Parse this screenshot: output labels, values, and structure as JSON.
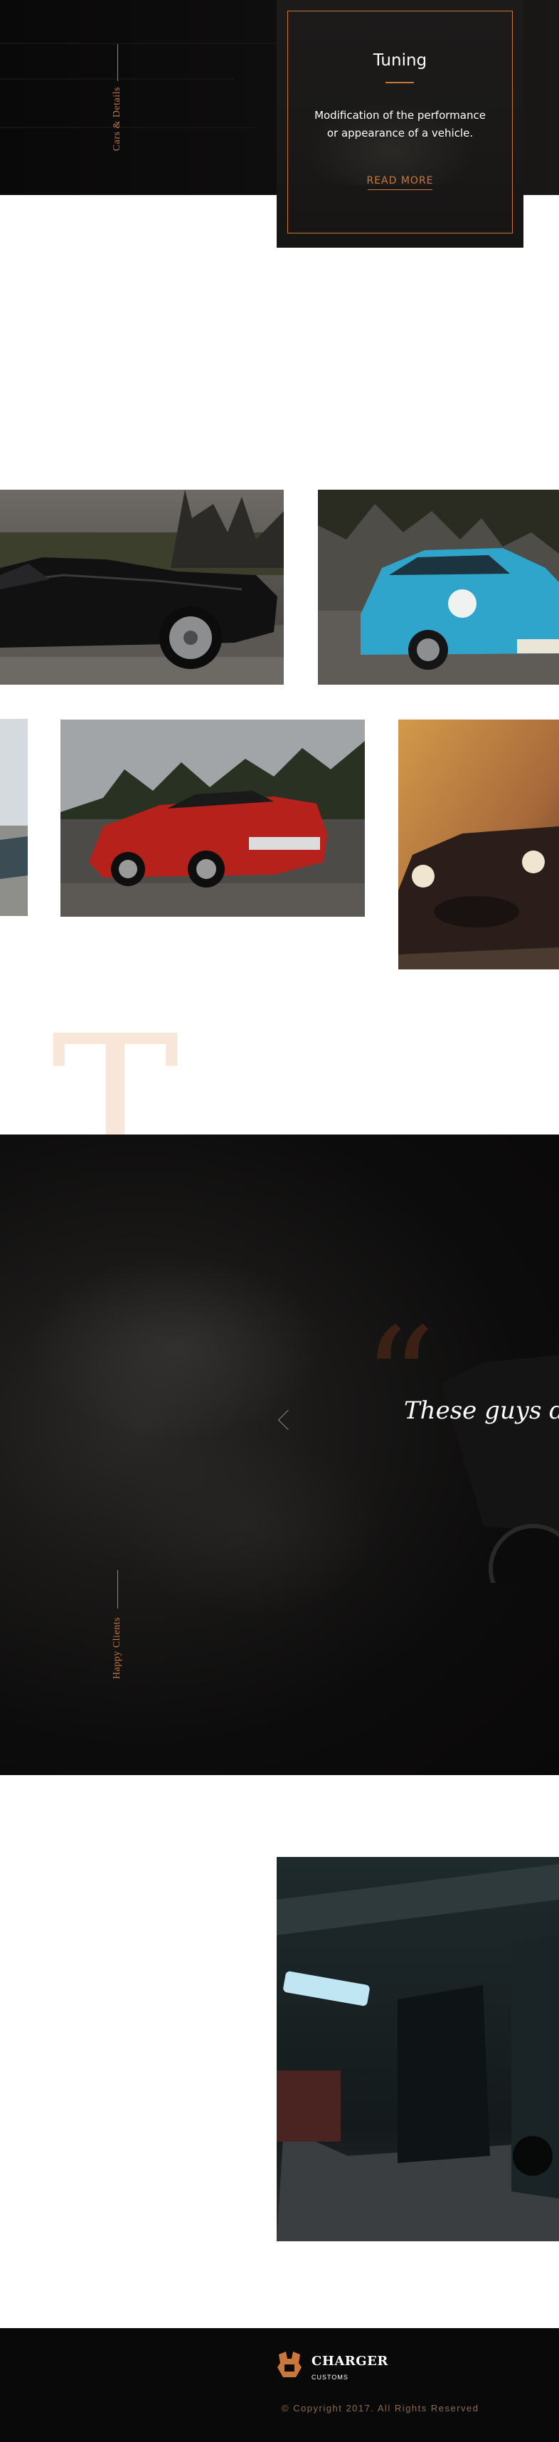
{
  "colors": {
    "accent": "#c9773a",
    "dark": "#0a0909",
    "light_t": "#f8e6d8"
  },
  "services": {
    "section_label": "Cars & Details",
    "card": {
      "title": "Tuning",
      "description": "Modification of the performance or appearance of a vehicle.",
      "link_label": "READ MORE"
    }
  },
  "gallery": {
    "images": [
      {
        "name": "black convertible car"
      },
      {
        "name": "blue porsche car"
      },
      {
        "name": "partial car"
      },
      {
        "name": "red classic muscle car"
      },
      {
        "name": "dark roadster car"
      }
    ]
  },
  "testimonials": {
    "big_letter": "T",
    "section_label": "Happy Clients",
    "quote_mark": "“",
    "quote_text": "These guys do",
    "prev_icon": "chevron-left-icon"
  },
  "footer": {
    "brand_name": "CHARGER",
    "brand_sub": "CUSTOMS",
    "logo_icon": "engine-logo-icon",
    "copyright": "© Copyright 2017. All Rights Reserved"
  }
}
